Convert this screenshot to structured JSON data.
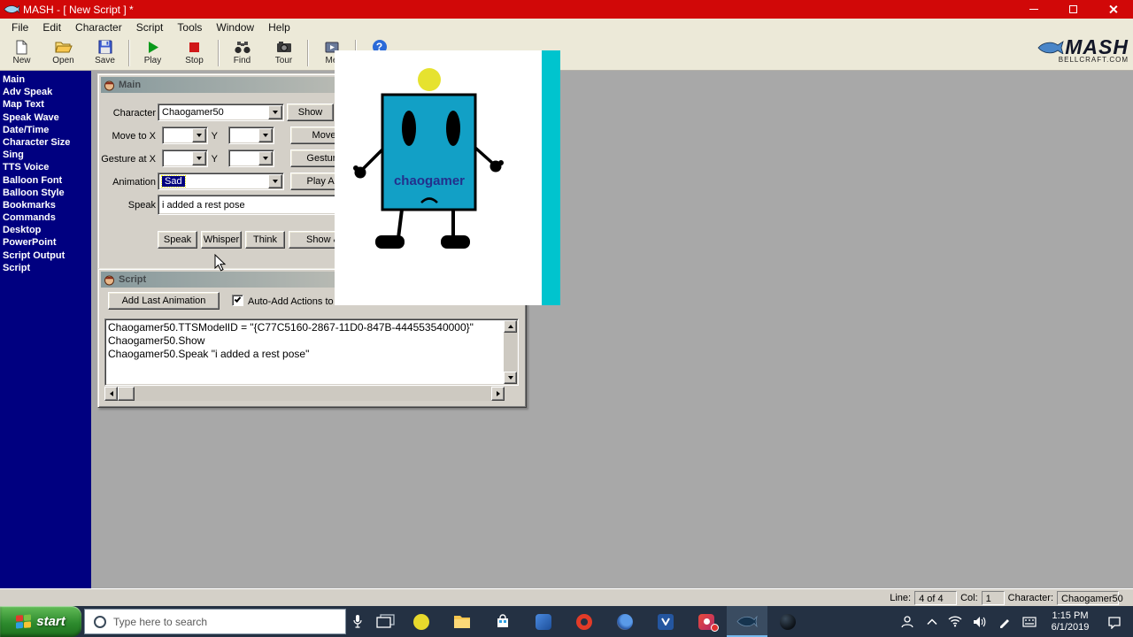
{
  "window": {
    "title": "MASH - [ New Script ] *"
  },
  "menu": {
    "items": [
      "File",
      "Edit",
      "Character",
      "Script",
      "Tools",
      "Window",
      "Help"
    ]
  },
  "toolbar": {
    "buttons": [
      "New",
      "Open",
      "Save",
      "Play",
      "Stop",
      "Find",
      "Tour",
      "Me"
    ],
    "help_glyph": "?",
    "brand_name": "MASH",
    "brand_sub": "BELLCRAFT.COM"
  },
  "sidebar": {
    "items": [
      "Main",
      "Adv Speak",
      "Map Text",
      "Speak Wave",
      "Date/Time",
      "Character Size",
      "Sing",
      "TTS Voice",
      "Balloon Font",
      "Balloon Style",
      "Bookmarks",
      "Commands",
      "Desktop",
      "PowerPoint",
      "Script Output",
      "Script"
    ]
  },
  "main_panel": {
    "title": "Main",
    "labels": {
      "character": "Character",
      "move_to_x": "Move to X",
      "y": "Y",
      "gesture_at_x": "Gesture at X",
      "animation": "Animation",
      "speak": "Speak"
    },
    "values": {
      "character": "Chaogamer50",
      "animation": "Sad",
      "speak": "i added a rest pose"
    },
    "buttons": {
      "show": "Show",
      "move": "Move",
      "gesture": "Gesture",
      "play_anim": "Play Anim",
      "speak": "Speak",
      "whisper": "Whisper",
      "think": "Think",
      "show_and": "Show &"
    }
  },
  "script_panel": {
    "title": "Script",
    "buttons": {
      "add_last_animation": "Add Last Animation"
    },
    "checkbox_label": "Auto-Add Actions to Sc",
    "lines": [
      "Chaogamer50.TTSModelID = \"{C77C5160-2867-11D0-847B-444553540000}\"",
      "Chaogamer50.Show",
      "Chaogamer50.Speak \"i added a rest pose\""
    ]
  },
  "character_overlay": {
    "name_text": "chaogamer"
  },
  "status_bar": {
    "line_label": "Line:",
    "line_value": "4 of 4",
    "col_label": "Col:",
    "col_value": "1",
    "character_label": "Character:",
    "character_value": "Chaogamer50"
  },
  "taskbar": {
    "start_label": "start",
    "search_placeholder": "Type here to search",
    "clock_time": "1:15 PM",
    "clock_date": "6/1/2019"
  }
}
